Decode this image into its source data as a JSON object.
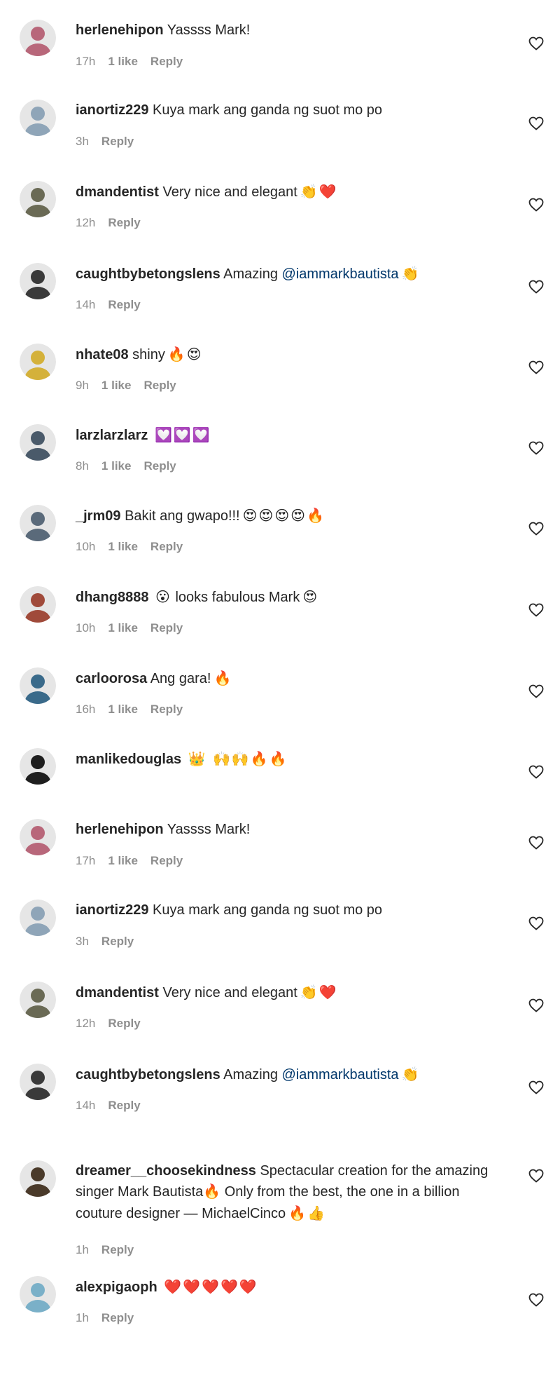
{
  "comments": [
    {
      "username": "herlenehipon",
      "text": "Yassss Mark!",
      "mention": "",
      "emoji": "",
      "time": "17h",
      "likes": "1 like",
      "reply": "Reply",
      "avatar_color": "#b8677a"
    },
    {
      "username": "ianortiz229",
      "text": "Kuya mark ang ganda ng suot mo po",
      "mention": "",
      "emoji": "",
      "time": "3h",
      "likes": "",
      "reply": "Reply",
      "avatar_color": "#8fa5b8"
    },
    {
      "username": "dmandentist",
      "text": "Very nice and elegant",
      "mention": "",
      "emoji": "👏❤️",
      "time": "12h",
      "likes": "",
      "reply": "Reply",
      "avatar_color": "#6a6a55"
    },
    {
      "username": "caughtbybetongslens",
      "text": "Amazing ",
      "mention": "@iammarkbautista",
      "emoji": "👏",
      "time": "14h",
      "likes": "",
      "reply": "Reply",
      "avatar_color": "#3a3a3a"
    },
    {
      "username": "nhate08",
      "text": "shiny",
      "mention": "",
      "emoji": "🔥😍",
      "time": "9h",
      "likes": "1 like",
      "reply": "Reply",
      "avatar_color": "#d4b13a"
    },
    {
      "username": "larzlarzlarz",
      "text": "",
      "mention": "",
      "emoji": "💟💟💟",
      "time": "8h",
      "likes": "1 like",
      "reply": "Reply",
      "avatar_color": "#4a5a6a"
    },
    {
      "username": "_jrm09",
      "text": "Bakit ang gwapo!!!",
      "mention": "",
      "emoji": "😍😍😍😍🔥",
      "time": "10h",
      "likes": "1 like",
      "reply": "Reply",
      "avatar_color": "#5a6a7a"
    },
    {
      "username": "dhang8888",
      "text": "looks fabulous Mark",
      "mention": "",
      "emoji": "😮",
      "emoji_after": "😍",
      "time": "10h",
      "likes": "1 like",
      "reply": "Reply",
      "avatar_color": "#a04a3a"
    },
    {
      "username": "carloorosa",
      "text": "Ang gara!",
      "mention": "",
      "emoji": "🔥",
      "time": "16h",
      "likes": "1 like",
      "reply": "Reply",
      "avatar_color": "#3a6a8a"
    },
    {
      "username": "manlikedouglas",
      "text": "",
      "mention": "",
      "emoji": "👑 🙌🙌🔥🔥",
      "time": "",
      "likes": "",
      "reply": "",
      "avatar_color": "#1e1e1e"
    },
    {
      "username": "herlenehipon",
      "text": "Yassss Mark!",
      "mention": "",
      "emoji": "",
      "time": "17h",
      "likes": "1 like",
      "reply": "Reply",
      "avatar_color": "#b8677a"
    },
    {
      "username": "ianortiz229",
      "text": "Kuya mark ang ganda ng suot mo po",
      "mention": "",
      "emoji": "",
      "time": "3h",
      "likes": "",
      "reply": "Reply",
      "avatar_color": "#8fa5b8"
    },
    {
      "username": "dmandentist",
      "text": "Very nice and elegant",
      "mention": "",
      "emoji": "👏❤️",
      "time": "12h",
      "likes": "",
      "reply": "Reply",
      "avatar_color": "#6a6a55"
    },
    {
      "username": "caughtbybetongslens",
      "text": "Amazing ",
      "mention": "@iammarkbautista",
      "emoji": "👏",
      "time": "14h",
      "likes": "",
      "reply": "Reply",
      "avatar_color": "#3a3a3a"
    },
    {
      "username": "dreamer__choosekindness",
      "text": "Spectacular creation for the amazing singer Mark Bautista🔥 Only from the best, the one in a billion couture designer — MichaelCinco",
      "mention": "",
      "emoji": "🔥👍",
      "time": "1h",
      "likes": "",
      "reply": "Reply",
      "avatar_color": "#4a3a2a"
    },
    {
      "username": "alexpigaoph",
      "text": "",
      "mention": "",
      "emoji": "❤️❤️❤️❤️❤️",
      "time": "1h",
      "likes": "",
      "reply": "Reply",
      "avatar_color": "#7ab0c8"
    }
  ]
}
